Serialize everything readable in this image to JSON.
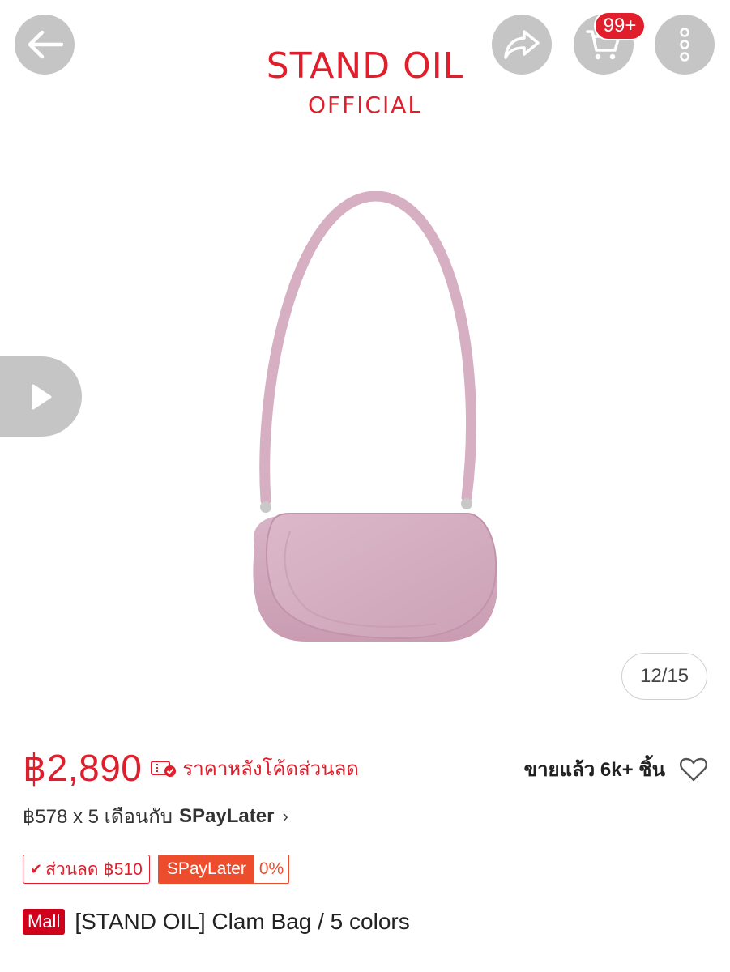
{
  "header": {
    "brand_line1": "STAND OIL",
    "brand_line2": "OFFICIAL",
    "cart_count": "99+"
  },
  "gallery": {
    "counter": "12/15"
  },
  "price": {
    "amount": "฿2,890",
    "note": "ราคาหลังโค้ดส่วนลด",
    "sold": "ขายแล้ว 6k+ ชิ้น"
  },
  "installment": {
    "text": "฿578 x 5 เดือนกับ",
    "brand": "SPayLater",
    "chevron": "›"
  },
  "tags": {
    "discount": "ส่วนลด ฿510",
    "spaylater": "SPayLater",
    "spaylater_rate": "0%"
  },
  "product": {
    "mall_badge": "Mall",
    "title": "[STAND OIL] Clam Bag / 5 colors"
  },
  "colors": {
    "accent": "#e01e2c",
    "shopee_orange": "#ee4d2d",
    "bag_pink": "#d6aec0"
  }
}
